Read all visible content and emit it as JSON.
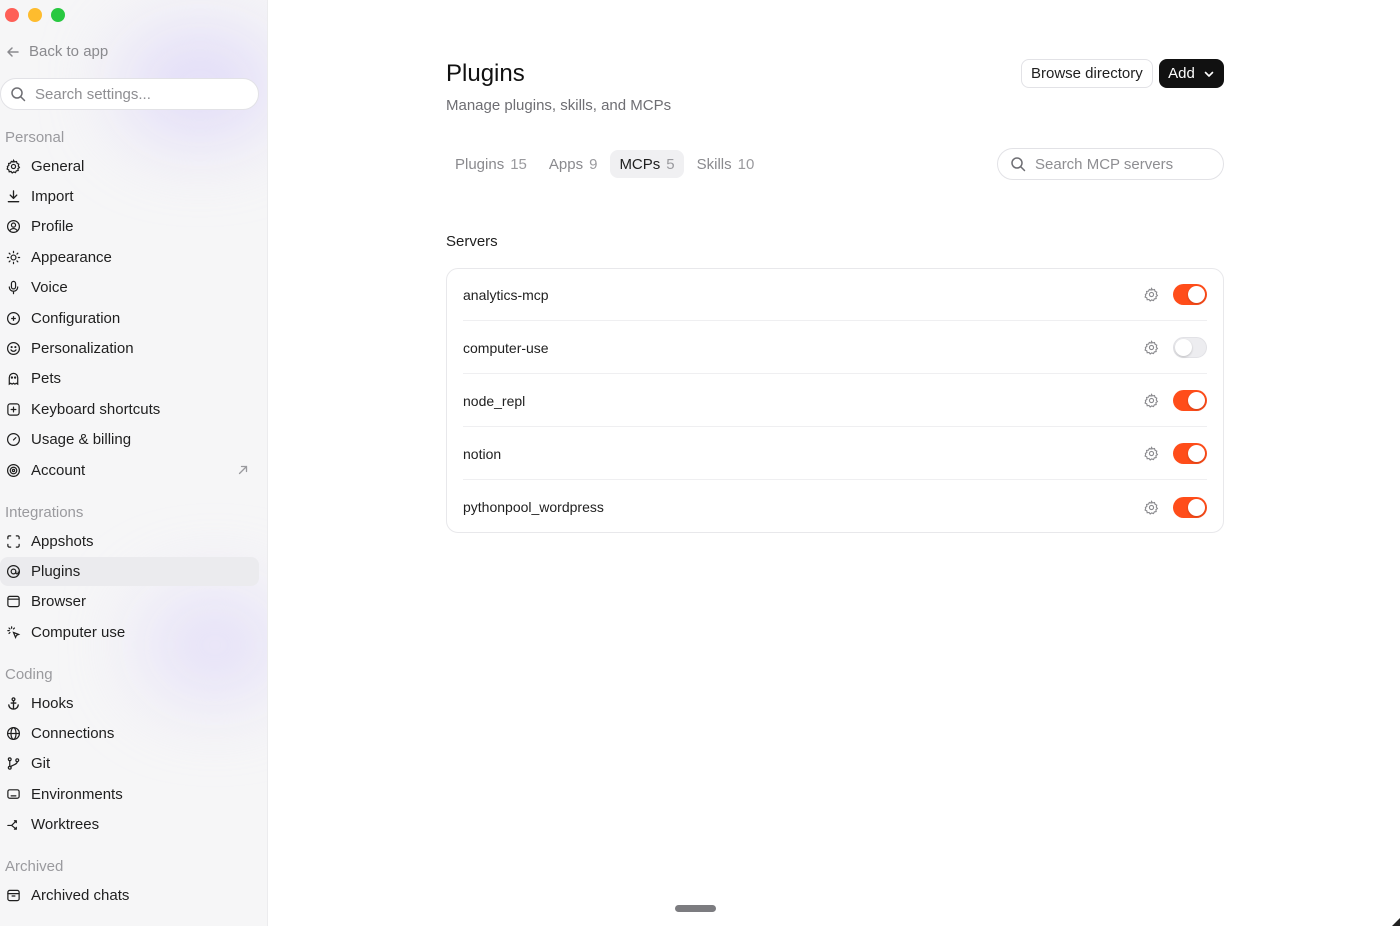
{
  "sidebar": {
    "back_label": "Back to app",
    "search_placeholder": "Search settings...",
    "sections": {
      "personal": "Personal",
      "integrations": "Integrations",
      "coding": "Coding",
      "archived": "Archived"
    },
    "items": {
      "general": "General",
      "import": "Import",
      "profile": "Profile",
      "appearance": "Appearance",
      "voice": "Voice",
      "configuration": "Configuration",
      "personalization": "Personalization",
      "pets": "Pets",
      "keyboard_shortcuts": "Keyboard shortcuts",
      "usage_billing": "Usage & billing",
      "account": "Account",
      "appshots": "Appshots",
      "plugins": "Plugins",
      "browser": "Browser",
      "computer_use": "Computer use",
      "hooks": "Hooks",
      "connections": "Connections",
      "git": "Git",
      "environments": "Environments",
      "worktrees": "Worktrees",
      "archived_chats": "Archived chats"
    },
    "active_item": "plugins"
  },
  "main": {
    "title": "Plugins",
    "subtitle": "Manage plugins, skills, and MCPs",
    "browse_label": "Browse directory",
    "add_label": "Add",
    "tabs": [
      {
        "label": "Plugins",
        "count": "15"
      },
      {
        "label": "Apps",
        "count": "9"
      },
      {
        "label": "MCPs",
        "count": "5"
      },
      {
        "label": "Skills",
        "count": "10"
      }
    ],
    "active_tab": "MCPs",
    "search_placeholder": "Search MCP servers",
    "servers_heading": "Servers",
    "servers": [
      {
        "name": "analytics-mcp",
        "enabled": true
      },
      {
        "name": "computer-use",
        "enabled": false
      },
      {
        "name": "node_repl",
        "enabled": true
      },
      {
        "name": "notion",
        "enabled": true
      },
      {
        "name": "pythonpool_wordpress",
        "enabled": true
      }
    ]
  },
  "colors": {
    "accent": "#ff4d1a",
    "add_button": "#111111",
    "sidebar_bg": "#f6f6f7"
  }
}
